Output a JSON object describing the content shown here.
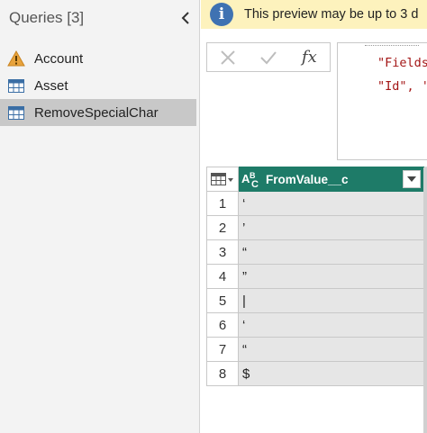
{
  "queries": {
    "header": "Queries [3]",
    "items": [
      {
        "name": "Account",
        "icon": "warning-icon",
        "selected": false
      },
      {
        "name": "Asset",
        "icon": "table-icon",
        "selected": false
      },
      {
        "name": "RemoveSpecialChar",
        "icon": "table-icon",
        "selected": true
      }
    ]
  },
  "banner": {
    "text": "This preview may be up to 3 d",
    "icon": "info-icon",
    "icon_glyph": "i",
    "background": "#fdf2bd"
  },
  "formula": {
    "fx_label": "fx",
    "line1": "\"Fields",
    "line2": "\"Id\", '"
  },
  "grid": {
    "column": {
      "name": "FromValue__c",
      "type_icon": "text-type-icon",
      "color": "#1e7b68"
    },
    "rows": [
      {
        "num": "1",
        "value": "‘"
      },
      {
        "num": "2",
        "value": "’"
      },
      {
        "num": "3",
        "value": "“"
      },
      {
        "num": "4",
        "value": "”"
      },
      {
        "num": "5",
        "value": "|"
      },
      {
        "num": "6",
        "value": "‘"
      },
      {
        "num": "7",
        "value": "“"
      },
      {
        "num": "8",
        "value": "$"
      }
    ]
  }
}
